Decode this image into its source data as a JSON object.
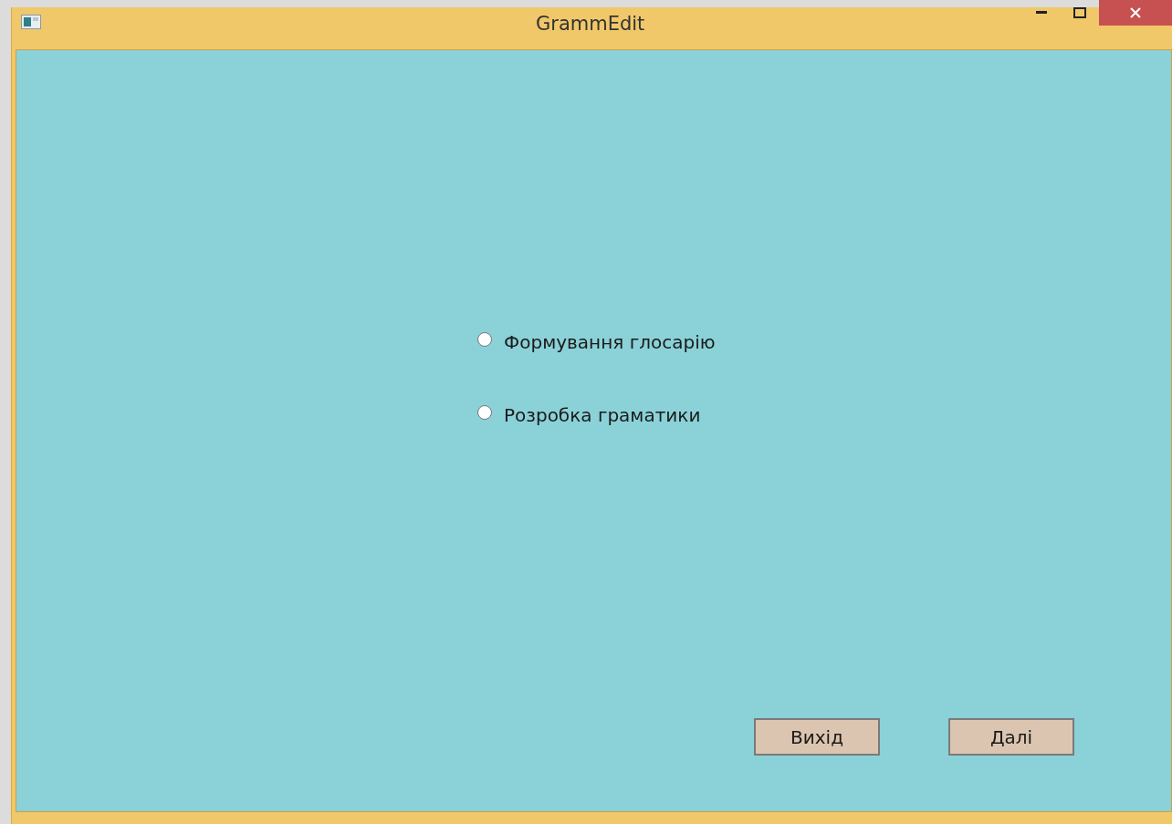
{
  "window": {
    "title": "GrammEdit"
  },
  "options": [
    {
      "label": "Формування глосарію",
      "selected": false
    },
    {
      "label": "Розробка граматики",
      "selected": false
    }
  ],
  "buttons": [
    {
      "label": "Вихід"
    },
    {
      "label": "Далі"
    }
  ]
}
